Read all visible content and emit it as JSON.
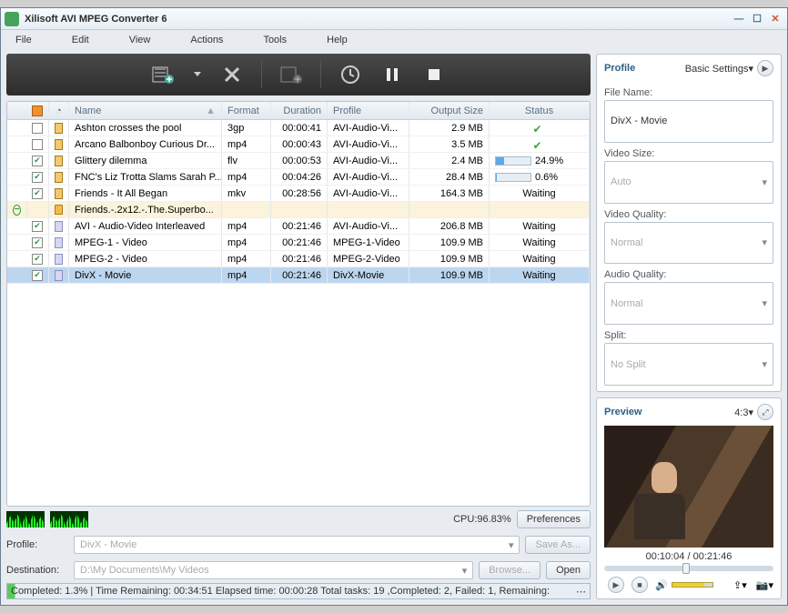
{
  "app": {
    "title": "Xilisoft AVI MPEG Converter 6"
  },
  "menu": [
    "File",
    "Edit",
    "View",
    "Actions",
    "Tools",
    "Help"
  ],
  "columns": {
    "name": "Name",
    "format": "Format",
    "duration": "Duration",
    "profile": "Profile",
    "output": "Output Size",
    "status": "Status"
  },
  "rows": [
    {
      "cb": false,
      "ico": "file",
      "name": "Ashton crosses the pool",
      "fmt": "3gp",
      "dur": "00:00:41",
      "prof": "AVI-Audio-Vi...",
      "out": "2.9 MB",
      "status": {
        "type": "ok"
      }
    },
    {
      "cb": false,
      "ico": "file",
      "name": "Arcano Balbonboy Curious Dr...",
      "fmt": "mp4",
      "dur": "00:00:43",
      "prof": "AVI-Audio-Vi...",
      "out": "3.5 MB",
      "status": {
        "type": "ok"
      }
    },
    {
      "cb": true,
      "ico": "file",
      "name": "Glittery dilemma",
      "fmt": "flv",
      "dur": "00:00:53",
      "prof": "AVI-Audio-Vi...",
      "out": "2.4 MB",
      "status": {
        "type": "prog",
        "pct": 24.9,
        "text": "24.9%"
      }
    },
    {
      "cb": true,
      "ico": "file",
      "name": "FNC's Liz Trotta Slams Sarah P...",
      "fmt": "mp4",
      "dur": "00:04:26",
      "prof": "AVI-Audio-Vi...",
      "out": "28.4 MB",
      "status": {
        "type": "prog",
        "pct": 0.6,
        "text": "0.6%"
      }
    },
    {
      "cb": true,
      "ico": "file",
      "name": "Friends - It All Began",
      "fmt": "mkv",
      "dur": "00:28:56",
      "prof": "AVI-Audio-Vi...",
      "out": "164.3 MB",
      "status": {
        "type": "wait",
        "text": "Waiting"
      }
    },
    {
      "cb": null,
      "ico": "folder",
      "name": "Friends.-.2x12.-.The.Superbo...",
      "fmt": "",
      "dur": "",
      "prof": "",
      "out": "",
      "status": {
        "type": ""
      },
      "folder": true
    },
    {
      "cb": true,
      "ico": "prof",
      "name": "AVI - Audio-Video Interleaved",
      "fmt": "mp4",
      "dur": "00:21:46",
      "prof": "AVI-Audio-Vi...",
      "out": "206.8 MB",
      "status": {
        "type": "wait",
        "text": "Waiting"
      },
      "sub": true
    },
    {
      "cb": true,
      "ico": "prof",
      "name": "MPEG-1 - Video",
      "fmt": "mp4",
      "dur": "00:21:46",
      "prof": "MPEG-1-Video",
      "out": "109.9 MB",
      "status": {
        "type": "wait",
        "text": "Waiting"
      },
      "sub": true
    },
    {
      "cb": true,
      "ico": "prof",
      "name": "MPEG-2 - Video",
      "fmt": "mp4",
      "dur": "00:21:46",
      "prof": "MPEG-2-Video",
      "out": "109.9 MB",
      "status": {
        "type": "wait",
        "text": "Waiting"
      },
      "sub": true
    },
    {
      "cb": true,
      "ico": "prof",
      "name": "DivX - Movie",
      "fmt": "mp4",
      "dur": "00:21:46",
      "prof": "DivX-Movie",
      "out": "109.9 MB",
      "status": {
        "type": "wait",
        "text": "Waiting"
      },
      "sub": true,
      "selected": true
    }
  ],
  "cpu": {
    "label": "CPU:96.83%",
    "prefs": "Preferences"
  },
  "bottom": {
    "profile_lbl": "Profile:",
    "profile_val": "DivX - Movie",
    "save_as": "Save As...",
    "dest_lbl": "Destination:",
    "dest_val": "D:\\My Documents\\My Videos",
    "browse": "Browse...",
    "open": "Open"
  },
  "status": "Completed: 1.3% | Time Remaining: 00:34:51 Elapsed time: 00:00:28 Total tasks: 19 ,Completed: 2, Failed: 1, Remaining:",
  "profile_panel": {
    "title": "Profile",
    "mode": "Basic Settings▾",
    "file_name_lbl": "File Name:",
    "file_name": "DivX - Movie",
    "vsize_lbl": "Video Size:",
    "vsize": "Auto",
    "vqual_lbl": "Video Quality:",
    "vqual": "Normal",
    "aqual_lbl": "Audio Quality:",
    "aqual": "Normal",
    "split_lbl": "Split:",
    "split": "No Split"
  },
  "preview": {
    "title": "Preview",
    "ratio": "4:3▾",
    "time": "00:10:04 / 00:21:46"
  }
}
